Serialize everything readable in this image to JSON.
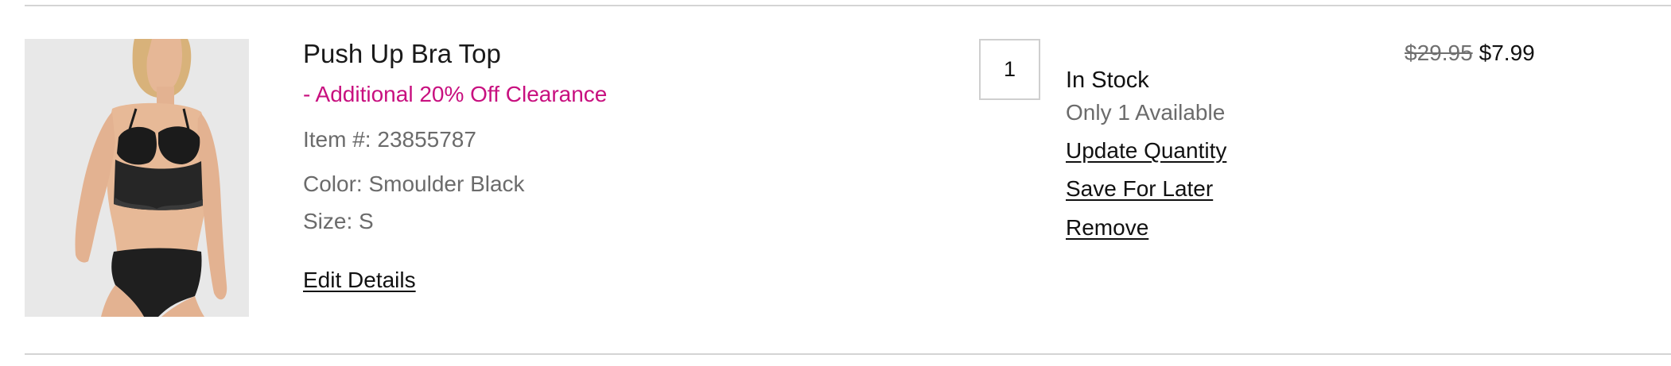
{
  "cart_item": {
    "name": "Push Up Bra Top",
    "promo": "- Additional 20% Off Clearance",
    "item_number": "Item #: 23855787",
    "color": "Color: Smoulder Black",
    "size": "Size: S",
    "edit_label": "Edit Details",
    "quantity": "1",
    "stock_status": "In Stock",
    "availability": "Only 1 Available",
    "update_label": "Update Quantity",
    "save_label": "Save For Later",
    "remove_label": "Remove",
    "original_price": "$29.95",
    "sale_price": "$7.99"
  },
  "colors": {
    "promo": "#c8107f",
    "muted_text": "#6b6b6b",
    "divider": "#d4d4d4",
    "image_background": "#e8e8e8"
  }
}
